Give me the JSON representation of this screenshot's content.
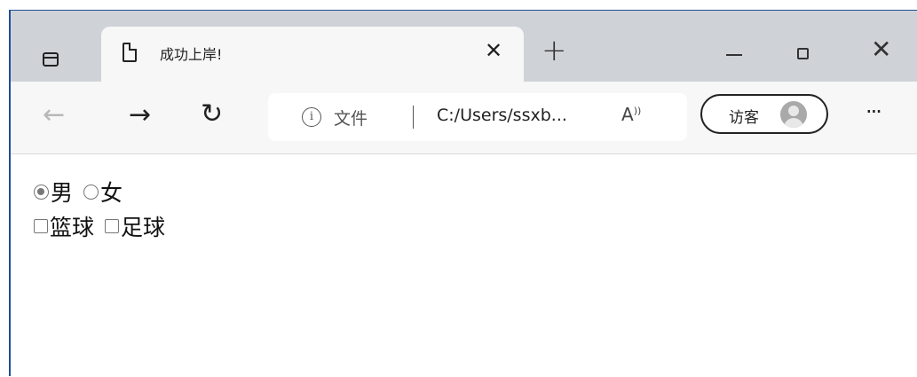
{
  "tab": {
    "title": "成功上岸!",
    "close_icon": "close-icon",
    "page_icon": "page-icon"
  },
  "window_controls": {
    "new_tab": "+",
    "minimize": "minimize-icon",
    "maximize": "maximize-icon",
    "close": "close-icon"
  },
  "toolbar": {
    "back_icon": "arrow-left-icon",
    "forward_icon": "arrow-right-icon",
    "refresh_icon": "refresh-icon",
    "address": {
      "info_icon": "info-icon",
      "scheme_label": "文件",
      "url": "C:/Users/ssxb...",
      "read_aloud": "A"
    },
    "profile": {
      "label": "访客"
    },
    "more": "···"
  },
  "form": {
    "gender": {
      "options": [
        {
          "label": "男",
          "checked": true
        },
        {
          "label": "女",
          "checked": false
        }
      ]
    },
    "hobbies": {
      "options": [
        {
          "label": "篮球",
          "checked": false
        },
        {
          "label": "足球",
          "checked": false
        }
      ]
    }
  },
  "colors": {
    "tabstrip": "#cfd3d8",
    "toolbar": "#f7f7f7",
    "watermark": "#f9b4b4",
    "window_border": "#1f4e99"
  }
}
